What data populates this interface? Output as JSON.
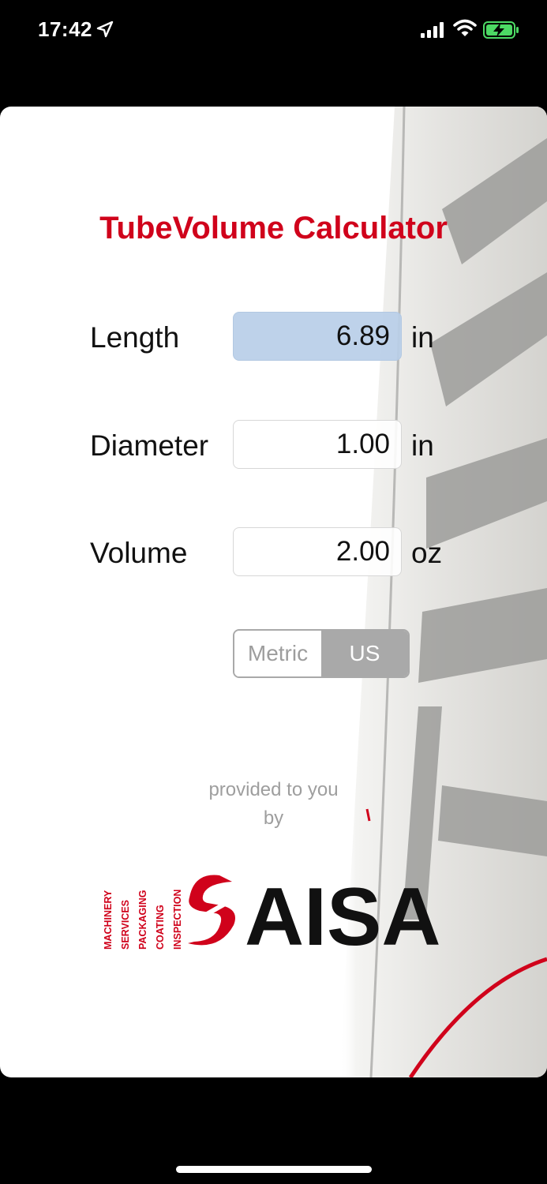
{
  "status_bar": {
    "time": "17:42",
    "icons": [
      "location-icon",
      "signal-icon",
      "wifi-icon",
      "battery-charging-icon"
    ],
    "battery_color": "#4cd964"
  },
  "app": {
    "title": "TubeVolume Calculator",
    "accent_color": "#d0021b",
    "fields": {
      "length": {
        "label": "Length",
        "value": "6.89",
        "unit": "in",
        "active": true
      },
      "diameter": {
        "label": "Diameter",
        "value": "1.00",
        "unit": "in"
      },
      "volume": {
        "label": "Volume",
        "value": "2.00",
        "unit": "oz"
      }
    },
    "unit_system": {
      "options": [
        "Metric",
        "US"
      ],
      "selected": "US"
    },
    "credit": {
      "line1": "provided to you",
      "line2": "by"
    },
    "logo": {
      "name": "SAISA",
      "taglines": [
        "MACHINERY",
        "SERVICES",
        "PACKAGING",
        "COATING",
        "INSPECTION"
      ]
    }
  }
}
